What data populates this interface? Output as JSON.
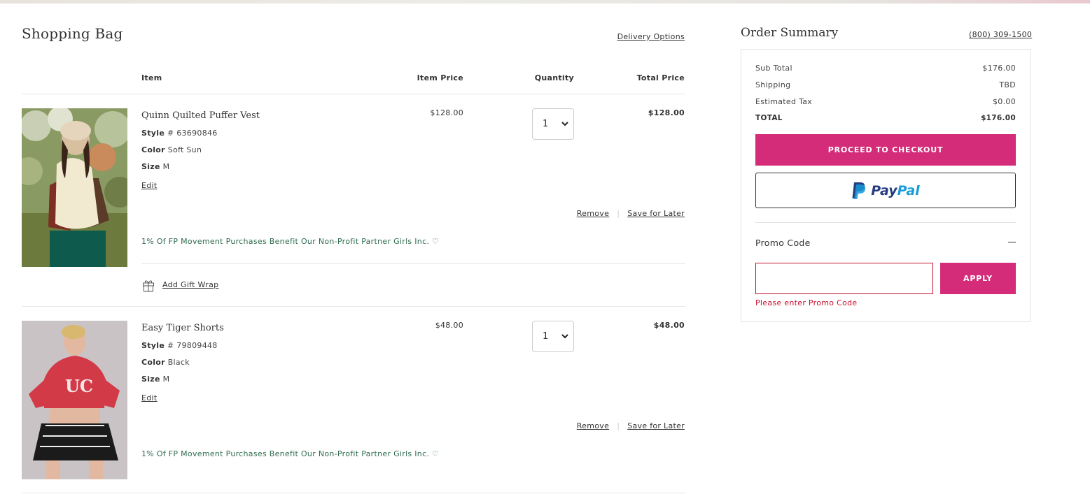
{
  "bag": {
    "title": "Shopping Bag",
    "delivery_link": "Delivery Options",
    "columns": {
      "item": "Item",
      "item_price": "Item Price",
      "quantity": "Quantity",
      "total_price": "Total Price"
    },
    "items": [
      {
        "name": "Quinn Quilted Puffer Vest",
        "style_label": "Style",
        "style_value": "# 63690846",
        "color_label": "Color",
        "color_value": "Soft Sun",
        "size_label": "Size",
        "size_value": "M",
        "edit": "Edit",
        "item_price": "$128.00",
        "quantity": "1",
        "total_price": "$128.00",
        "remove": "Remove",
        "save_for_later": "Save for Later",
        "promo_message": "1% Of FP Movement Purchases Benefit Our Non-Profit Partner Girls Inc. ♡"
      },
      {
        "name": "Easy Tiger Shorts",
        "style_label": "Style",
        "style_value": "# 79809448",
        "color_label": "Color",
        "color_value": "Black",
        "size_label": "Size",
        "size_value": "M",
        "edit": "Edit",
        "item_price": "$48.00",
        "quantity": "1",
        "total_price": "$48.00",
        "remove": "Remove",
        "save_for_later": "Save for Later",
        "promo_message": "1% Of FP Movement Purchases Benefit Our Non-Profit Partner Girls Inc. ♡"
      }
    ],
    "gift_wrap": "Add Gift Wrap",
    "gift_icon": "gift-icon"
  },
  "summary": {
    "title": "Order Summary",
    "phone": "(800) 309-1500",
    "rows": [
      {
        "label": "Sub Total",
        "value": "$176.00"
      },
      {
        "label": "Shipping",
        "value": "TBD"
      },
      {
        "label": "Estimated Tax",
        "value": "$0.00"
      },
      {
        "label": "TOTAL",
        "value": "$176.00"
      }
    ],
    "checkout": "PROCEED TO CHECKOUT",
    "paypal_pay": "Pay",
    "paypal_pal": "Pal",
    "promo_label": "Promo Code",
    "promo_placeholder": "",
    "apply": "APPLY",
    "promo_error": "Please enter Promo Code"
  },
  "colors": {
    "accent": "#d42c78",
    "error": "#c8102e",
    "promo_green": "#2e6b4f",
    "paypal_dark": "#253b80",
    "paypal_light": "#179bd7"
  }
}
